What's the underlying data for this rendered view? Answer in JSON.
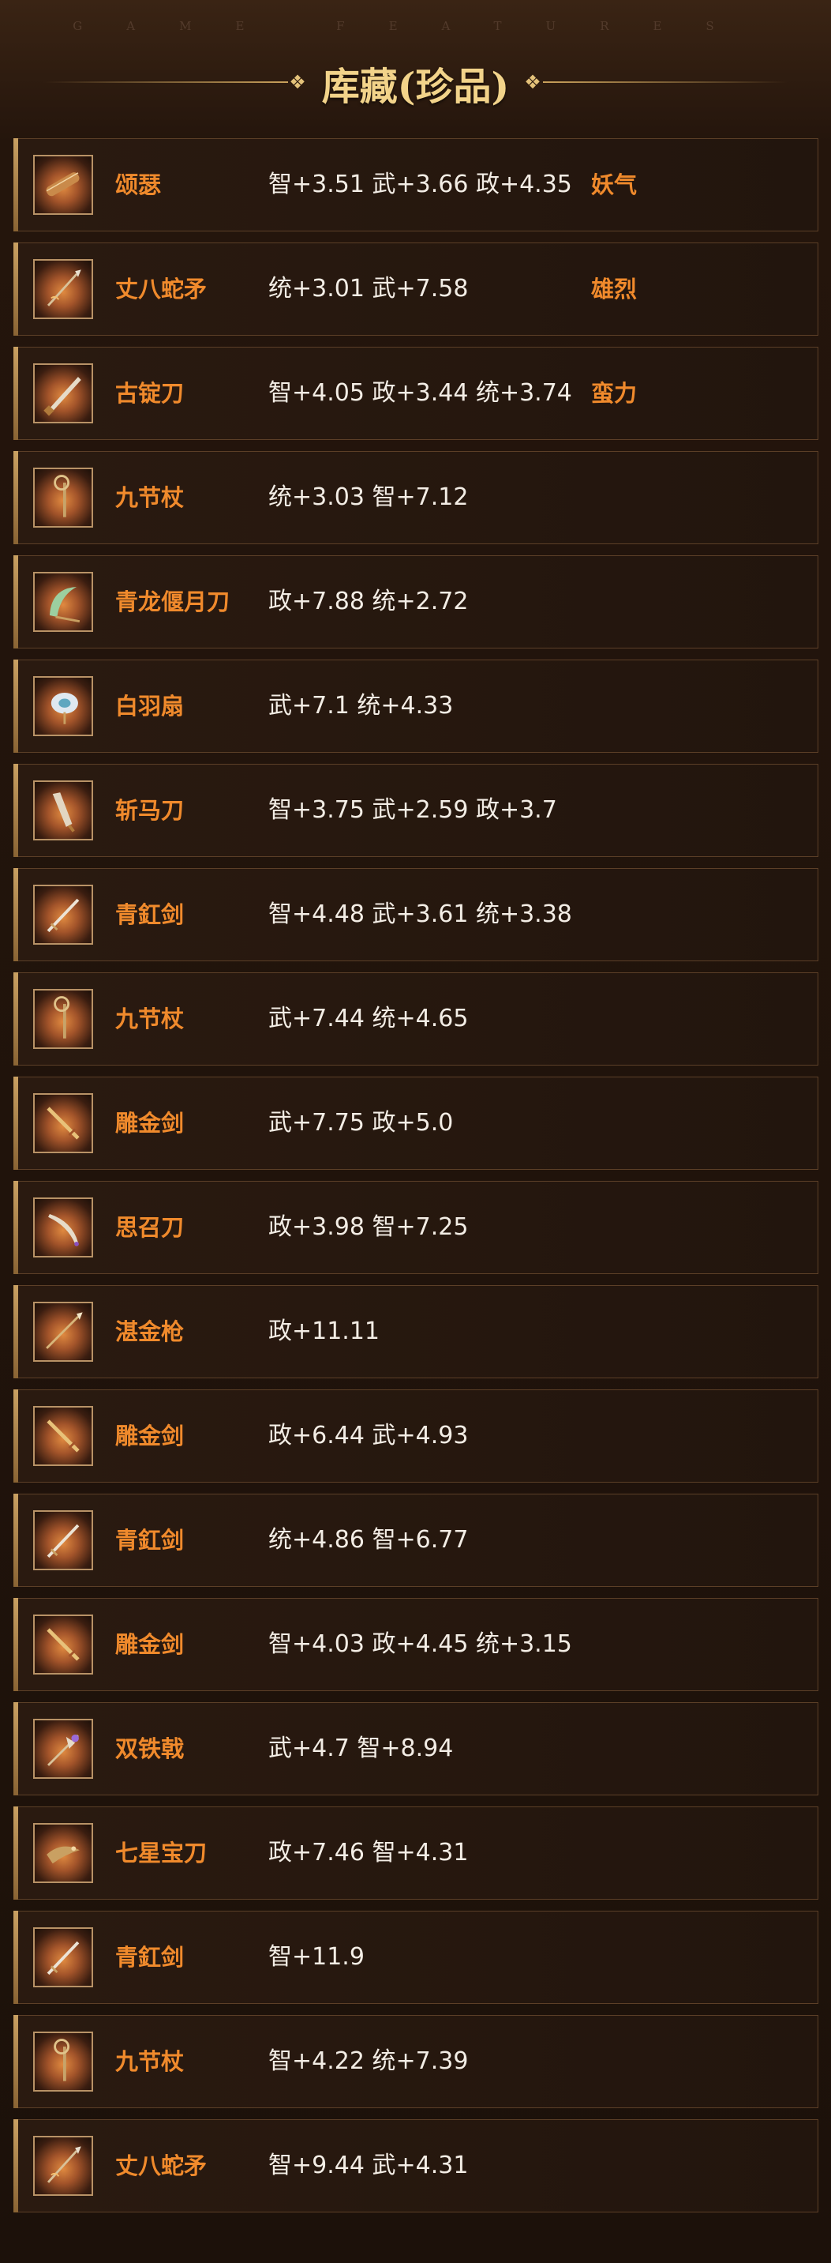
{
  "header": {
    "watermark": "GAME FEATURES",
    "title": "库藏(珍品)"
  },
  "items": [
    {
      "name": "颂瑟",
      "stats": "智+3.51 武+3.66 政+4.35",
      "trait": "妖气",
      "icon": "qin-instrument-icon"
    },
    {
      "name": "丈八蛇矛",
      "stats": "统+3.01 武+7.58",
      "trait": "雄烈",
      "icon": "serpent-spear-icon"
    },
    {
      "name": "古锭刀",
      "stats": "智+4.05 政+3.44 统+3.74",
      "trait": "蛮力",
      "icon": "saber-icon"
    },
    {
      "name": "九节杖",
      "stats": "统+3.03 智+7.12",
      "trait": "",
      "icon": "staff-icon"
    },
    {
      "name": "青龙偃月刀",
      "stats": "政+7.88 统+2.72",
      "trait": "",
      "icon": "crescent-blade-icon"
    },
    {
      "name": "白羽扇",
      "stats": "武+7.1 统+4.33",
      "trait": "",
      "icon": "feather-fan-icon"
    },
    {
      "name": "斩马刀",
      "stats": "智+3.75 武+2.59 政+3.7",
      "trait": "",
      "icon": "broad-blade-icon"
    },
    {
      "name": "青釭剑",
      "stats": "智+4.48 武+3.61 统+3.38",
      "trait": "",
      "icon": "sword-icon"
    },
    {
      "name": "九节杖",
      "stats": "武+7.44 统+4.65",
      "trait": "",
      "icon": "staff-icon"
    },
    {
      "name": "雕金剑",
      "stats": "武+7.75 政+5.0",
      "trait": "",
      "icon": "golden-sword-icon"
    },
    {
      "name": "思召刀",
      "stats": "政+3.98 智+7.25",
      "trait": "",
      "icon": "curved-blade-icon"
    },
    {
      "name": "湛金枪",
      "stats": "政+11.11",
      "trait": "",
      "icon": "spear-icon"
    },
    {
      "name": "雕金剑",
      "stats": "政+6.44 武+4.93",
      "trait": "",
      "icon": "golden-sword-icon"
    },
    {
      "name": "青釭剑",
      "stats": "统+4.86 智+6.77",
      "trait": "",
      "icon": "sword-icon"
    },
    {
      "name": "雕金剑",
      "stats": "智+4.03 政+4.45 统+3.15",
      "trait": "",
      "icon": "golden-sword-icon"
    },
    {
      "name": "双铁戟",
      "stats": "武+4.7 智+8.94",
      "trait": "",
      "icon": "halberd-icon"
    },
    {
      "name": "七星宝刀",
      "stats": "政+7.46 智+4.31",
      "trait": "",
      "icon": "dragon-blade-icon"
    },
    {
      "name": "青釭剑",
      "stats": "智+11.9",
      "trait": "",
      "icon": "sword-icon"
    },
    {
      "name": "九节杖",
      "stats": "智+4.22 统+7.39",
      "trait": "",
      "icon": "staff-icon"
    },
    {
      "name": "丈八蛇矛",
      "stats": "智+9.44 武+4.31",
      "trait": "",
      "icon": "serpent-spear-icon"
    }
  ],
  "colors": {
    "name": "#f08a2c",
    "stats": "#f3ede5",
    "title": "#f2d38a",
    "border": "#5c3f27"
  }
}
